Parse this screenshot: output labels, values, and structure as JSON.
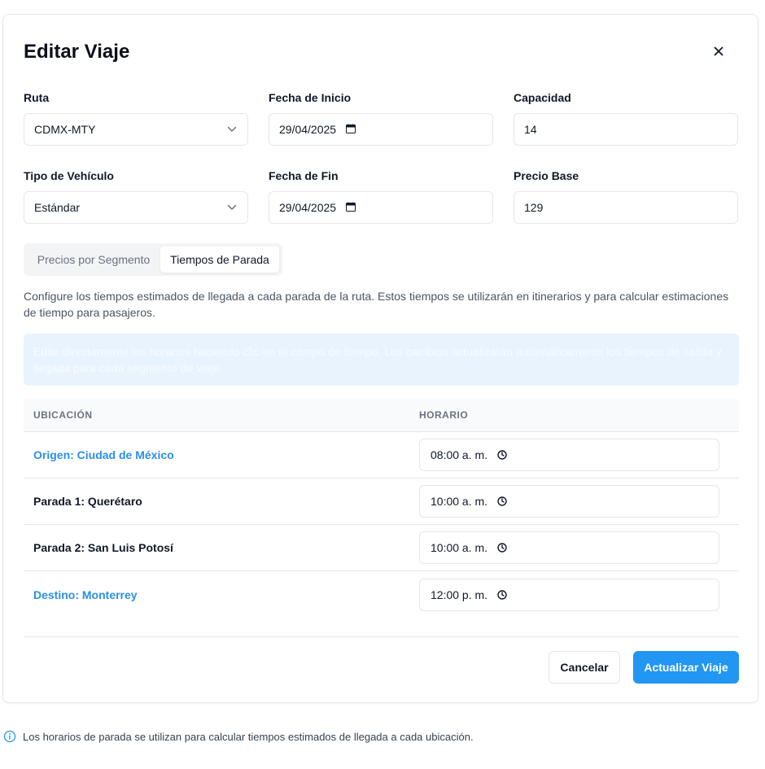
{
  "dialog": {
    "title": "Editar Viaje",
    "close_icon": "close-icon"
  },
  "form": {
    "route": {
      "label": "Ruta",
      "value": "CDMX-MTY"
    },
    "start_date": {
      "label": "Fecha de Inicio",
      "value": "29/04/2025"
    },
    "capacity": {
      "label": "Capacidad",
      "value": "14"
    },
    "vehicle_type": {
      "label": "Tipo de Vehículo",
      "value": "Estándar"
    },
    "end_date": {
      "label": "Fecha de Fin",
      "value": "29/04/2025"
    },
    "base_price": {
      "label": "Precio Base",
      "value": "129"
    }
  },
  "tabs": [
    {
      "label": "Precios por Segmento",
      "active": false
    },
    {
      "label": "Tiempos de Parada",
      "active": true
    }
  ],
  "description": "Configure los tiempos estimados de llegada a cada parada de la ruta. Estos tiempos se utilizarán en itinerarios y para calcular estimaciones de tiempo para pasajeros.",
  "info_box": "Edite directamente los horarios haciendo clic en el campo de tiempo. Los cambios actualizarán automáticamente los tiempos de salida y llegada para cada segmento de viaje.",
  "table": {
    "headers": {
      "location": "UBICACIÓN",
      "schedule": "HORARIO"
    },
    "rows": [
      {
        "location": "Origen: Ciudad de México",
        "time": "08:00 a. m."
      },
      {
        "location": "Parada 1: Querétaro",
        "time": "10:00 a. m."
      },
      {
        "location": "Parada 2: San Luis Potosí",
        "time": "10:00 a. m."
      },
      {
        "location": "Destino: Monterrey",
        "time": "12:00 p. m."
      }
    ]
  },
  "buttons": {
    "cancel": "Cancelar",
    "submit": "Actualizar Viaje"
  },
  "footer_note": "Los horarios de parada se utilizan para calcular tiempos estimados de llegada a cada ubicación.",
  "colors": {
    "primary": "#2196f3",
    "link_blue": "#2a8fe6",
    "info_bg": "#e8f3fe"
  }
}
